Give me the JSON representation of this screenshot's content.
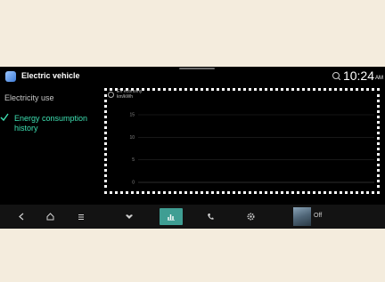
{
  "header": {
    "app_title": "Electric vehicle",
    "time": "10:24",
    "ampm": "AM",
    "app_icon": "ev-app-icon",
    "status_icon": "signal-icon"
  },
  "sidebar": {
    "items": [
      {
        "label": "Electricity use",
        "selected": false
      },
      {
        "label": "Energy consumption history",
        "selected": true
      }
    ],
    "selected_color": "#3ee0b2"
  },
  "chart": {
    "label_line1": "EV economy",
    "label_line2": "km/kWh",
    "yticks": [
      "15",
      "10",
      "5",
      "0"
    ],
    "highlight": "dotted-white-border"
  },
  "chart_data": {
    "type": "bar",
    "title": "",
    "ylabel": "EV economy km/kWh",
    "ylim": [
      0,
      20
    ],
    "yticks": [
      0,
      5,
      10,
      15
    ],
    "categories": [],
    "values": [],
    "grid": true
  },
  "nav": {
    "items": [
      "back-icon",
      "home-icon",
      "menu-icon",
      "climate-fan-icon",
      "chart-icon",
      "phone-icon",
      "settings-icon"
    ],
    "active": "chart-icon",
    "active_color": "#3f9e93",
    "media_label": "Off"
  }
}
